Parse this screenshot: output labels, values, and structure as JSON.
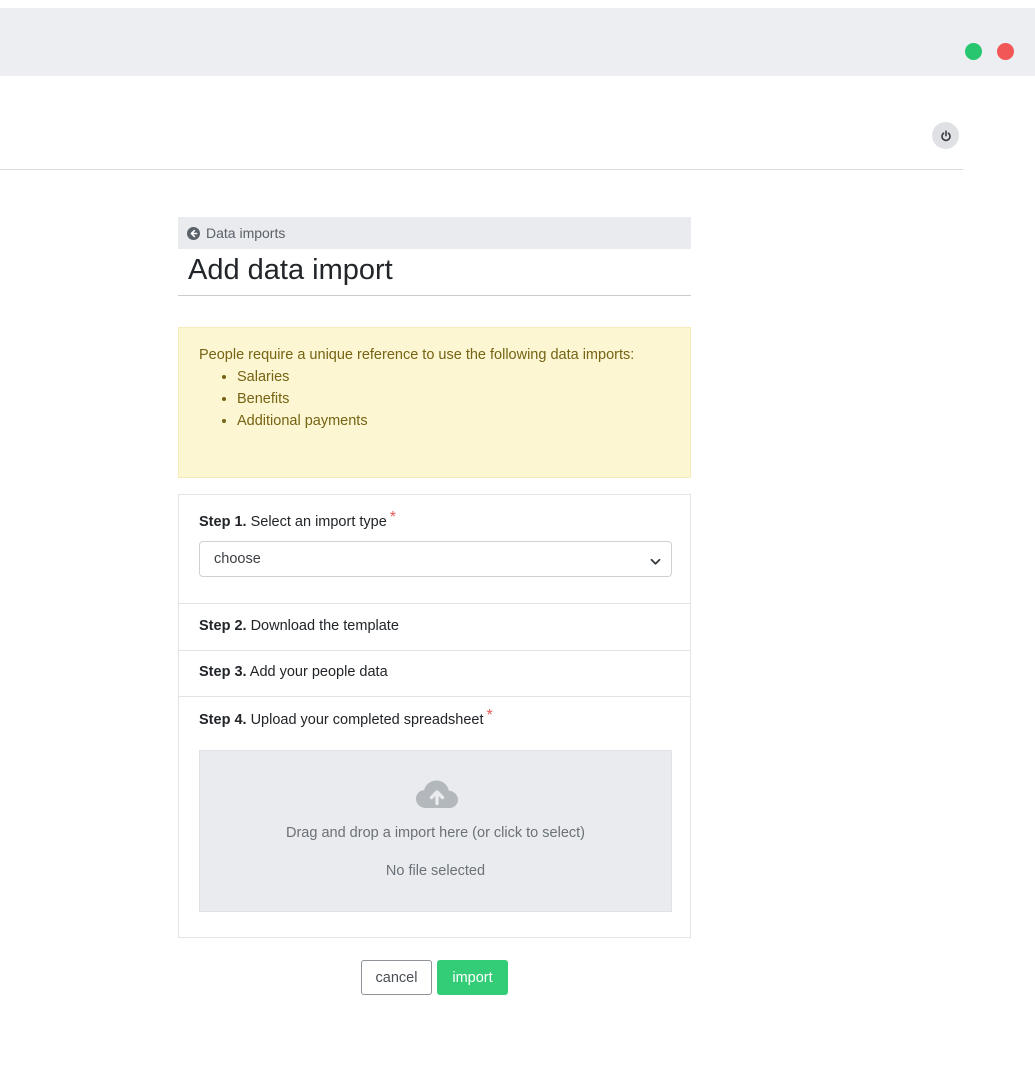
{
  "window": {
    "controls": [
      "green-dot",
      "red-dot"
    ]
  },
  "header": {
    "power_icon": "power-icon"
  },
  "back_link": {
    "label": "Data imports",
    "icon": "arrow-circle-left-icon"
  },
  "page": {
    "title": "Add data import"
  },
  "alert": {
    "text": "People require a unique reference to use the following data imports:",
    "items": [
      "Salaries",
      "Benefits",
      "Additional payments"
    ]
  },
  "steps": [
    {
      "number": "Step 1.",
      "text": "Select an import type",
      "required": "*"
    },
    {
      "number": "Step 2.",
      "text": "Download the template"
    },
    {
      "number": "Step 3.",
      "text": "Add your people data"
    },
    {
      "number": "Step 4.",
      "text": "Upload your completed spreadsheet",
      "required": "*"
    }
  ],
  "import_type_select": {
    "selected": "choose"
  },
  "dropzone": {
    "icon": "cloud-upload-icon",
    "instruction": "Drag and drop a import here (or click to select)",
    "status": "No file selected"
  },
  "buttons": {
    "cancel": "cancel",
    "import": "import"
  },
  "colors": {
    "accent": "#33cc77",
    "alert_bg": "#fcf6d3",
    "alert_text": "#766313",
    "required": "#e85a5a"
  }
}
